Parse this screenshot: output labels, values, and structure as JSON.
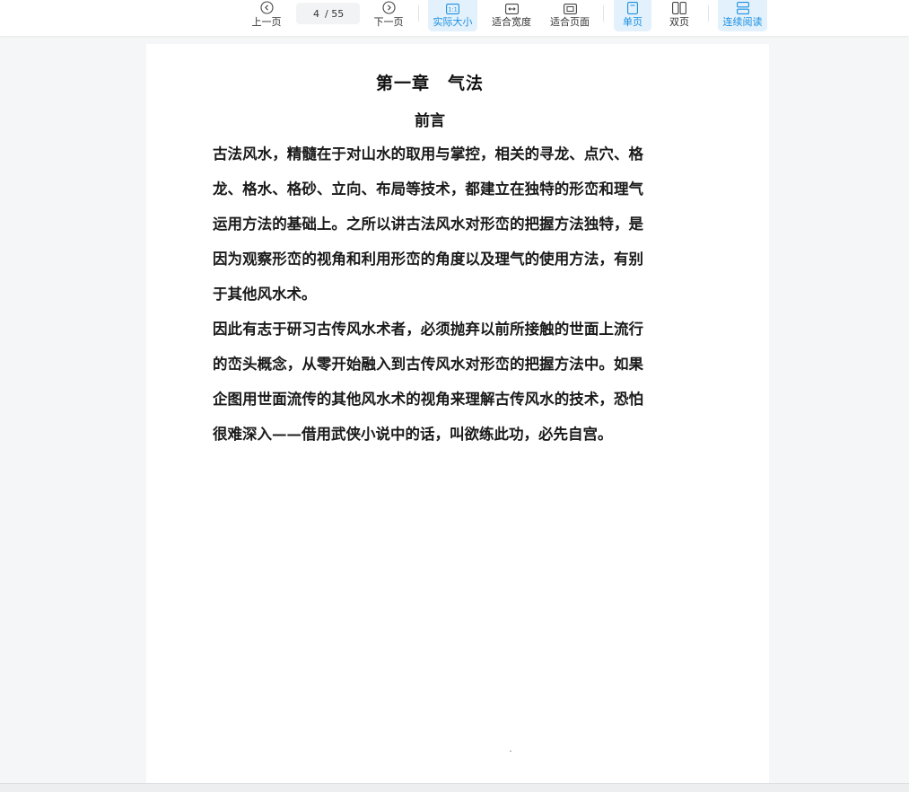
{
  "toolbar": {
    "prev_label": "上一页",
    "next_label": "下一页",
    "current_page": "4",
    "total_pages": "/ 55",
    "actual_size_label": "实际大小",
    "fit_width_label": "适合宽度",
    "fit_page_label": "适合页面",
    "single_page_label": "单页",
    "double_page_label": "双页",
    "continuous_label": "连续阅读",
    "accent_color": "#1a8fe0",
    "active_bg": "#e3f1fc"
  },
  "document": {
    "title": "第一章　气法",
    "subtitle": "前言",
    "paragraphs": [
      "古法风水，精髓在于对山水的取用与掌控，相关的寻龙、点穴、格龙、格水、格砂、立向、布局等技术，都建立在独特的形峦和理气运用方法的基础上。之所以讲古法风水对形峦的把握方法独特，是因为观察形峦的视角和利用形峦的角度以及理气的使用方法，有别于其他风水术。",
      "因此有志于研习古传风水术者，必须抛弃以前所接触的世面上流行的峦头概念，从零开始融入到古传风水对形峦的把握方法中。如果企图用世面流传的其他风水术的视角来理解古传风水的技术，恐怕很难深入——借用武侠小说中的话，叫欲练此功，必先自宫。"
    ]
  }
}
